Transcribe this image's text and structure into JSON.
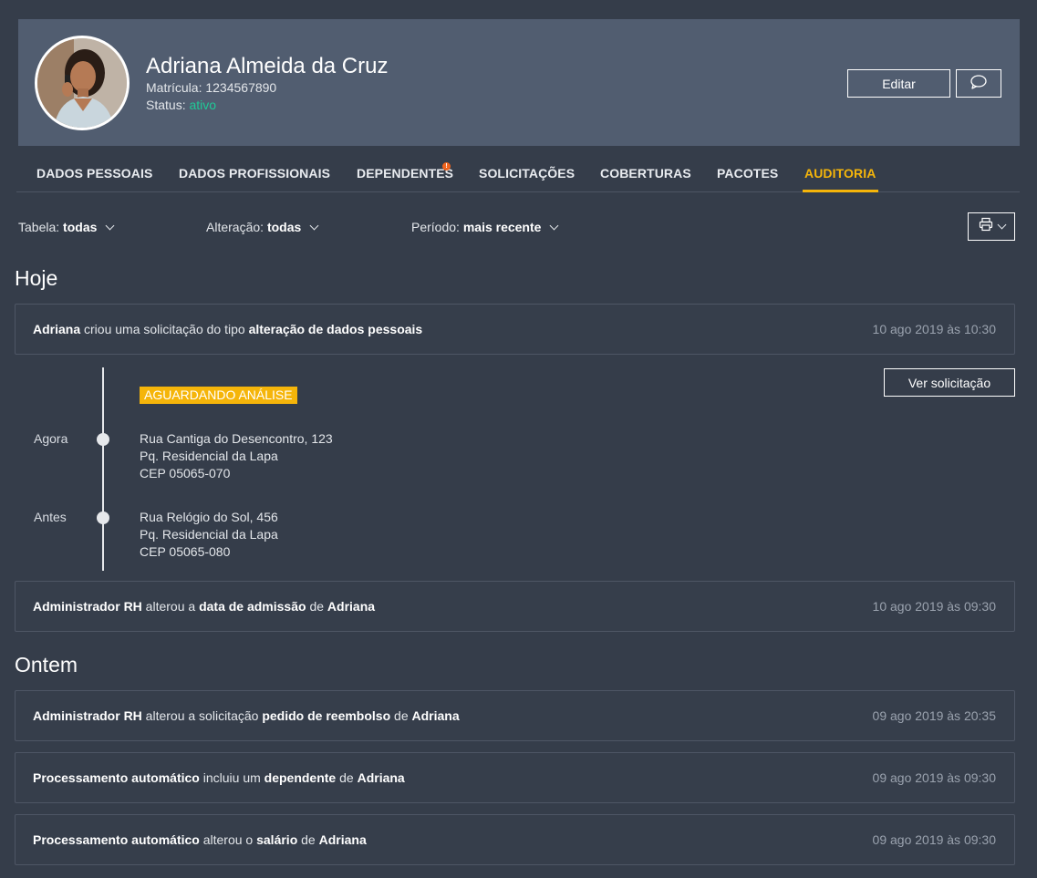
{
  "profile": {
    "name": "Adriana Almeida da Cruz",
    "matricula_label": "Matrícula:",
    "matricula_value": "1234567890",
    "status_label": "Status:",
    "status_value": "ativo",
    "edit_label": "Editar"
  },
  "tabs": [
    {
      "label": "DADOS PESSOAIS"
    },
    {
      "label": "DADOS PROFISSIONAIS"
    },
    {
      "label": "DEPENDENTES",
      "alert": "!"
    },
    {
      "label": "SOLICITAÇÕES"
    },
    {
      "label": "COBERTURAS"
    },
    {
      "label": "PACOTES"
    },
    {
      "label": "AUDITORIA",
      "active": true
    }
  ],
  "filters": {
    "tabela_label": "Tabela:",
    "tabela_value": "todas",
    "alteracao_label": "Alteração:",
    "alteracao_value": "todas",
    "periodo_label": "Período:",
    "periodo_value": "mais recente"
  },
  "sections": {
    "today": "Hoje",
    "yesterday": "Ontem"
  },
  "events": [
    {
      "actor": "Adriana",
      "text1": " criou uma solicitação do tipo ",
      "object": "alteração de dados pessoais",
      "time": "10 ago 2019 às 10:30"
    },
    {
      "actor": "Administrador RH",
      "text1": " alterou a ",
      "object": "data de admissão",
      "text2": " de ",
      "target": "Adriana",
      "time": "10 ago 2019 às 09:30"
    },
    {
      "actor": "Administrador RH",
      "text1": " alterou a solicitação ",
      "object": "pedido de reembolso",
      "text2": " de ",
      "target": "Adriana",
      "time": "09 ago 2019 às 20:35"
    },
    {
      "actor": "Processamento automático",
      "text1": " incluiu um ",
      "object": "dependente",
      "text2": " de ",
      "target": "Adriana",
      "time": "09 ago 2019 às 09:30"
    },
    {
      "actor": "Processamento automático",
      "text1": " alterou o ",
      "object": "salário",
      "text2": " de ",
      "target": "Adriana",
      "time": "09 ago 2019 às 09:30"
    }
  ],
  "detail": {
    "badge": "AGUARDANDO ANÁLISE",
    "view_button": "Ver solicitação",
    "now_label": "Agora",
    "before_label": "Antes",
    "now_address": [
      "Rua Cantiga do Desencontro, 123",
      "Pq. Residencial da Lapa",
      "CEP 05065-070"
    ],
    "before_address": [
      "Rua Relógio do Sol, 456",
      "Pq. Residencial da Lapa",
      "CEP 05065-080"
    ]
  },
  "colors": {
    "background": "#353d4a",
    "header": "#515d70",
    "accent": "#f5b50a",
    "status": "#20c997",
    "alert": "#f0641e"
  }
}
